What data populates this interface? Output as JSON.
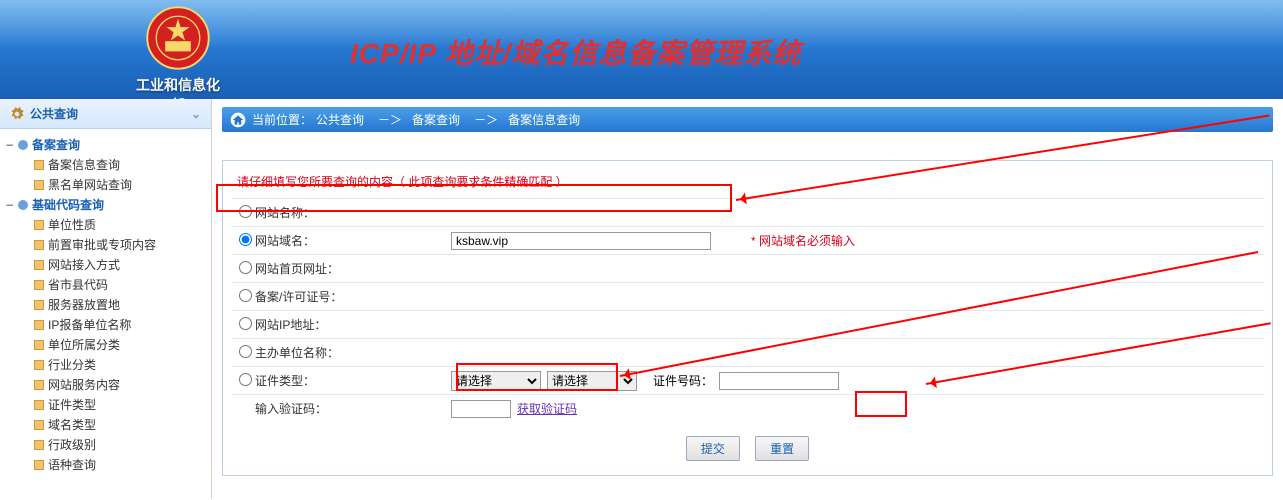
{
  "header": {
    "org_name": "工业和信息化部",
    "system_title": "ICP/IP 地址/域名信息备案管理系统"
  },
  "sidebar": {
    "title": "公共查询",
    "groups": [
      {
        "label": "备案查询",
        "items": [
          "备案信息查询",
          "黑名单网站查询"
        ]
      },
      {
        "label": "基础代码查询",
        "items": [
          "单位性质",
          "前置审批或专项内容",
          "网站接入方式",
          "省市县代码",
          "服务器放置地",
          "IP报备单位名称",
          "单位所属分类",
          "行业分类",
          "网站服务内容",
          "证件类型",
          "域名类型",
          "行政级别",
          "语种查询"
        ]
      }
    ]
  },
  "breadcrumb": {
    "prefix": "当前位置：",
    "p1": "公共查询",
    "sep": "－＞",
    "p2": "备案查询",
    "p3": "备案信息查询"
  },
  "form": {
    "hint": "请仔细填写您所要查询的内容（ 此项查询要求条件精确匹配 ）",
    "rows": {
      "site_name": "网站名称：",
      "domain": "网站域名：",
      "homepage": "网站首页网址：",
      "license": "备案/许可证号：",
      "ip": "网站IP地址：",
      "sponsor": "主办单位名称：",
      "cert_type": "证件类型：",
      "captcha": "输入验证码："
    },
    "domain_value": "ksbaw.vip",
    "cert_select_placeholder": "请选择",
    "cert_no_label": "证件号码：",
    "required_note": "* 网站域名必须输入",
    "captcha_link": "获取验证码",
    "submit": "提交",
    "reset": "重置"
  }
}
